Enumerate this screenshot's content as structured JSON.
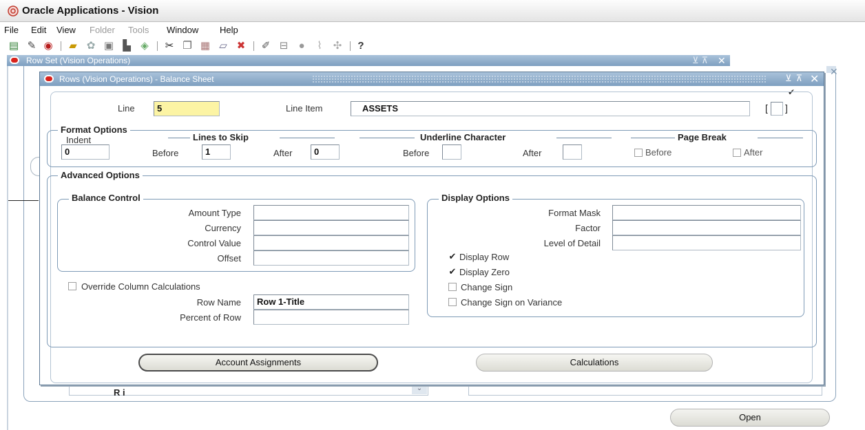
{
  "app": {
    "title": "Oracle Applications - Vision"
  },
  "menu": [
    {
      "label": "File",
      "enabled": true
    },
    {
      "label": "Edit",
      "enabled": true
    },
    {
      "label": "View",
      "enabled": true
    },
    {
      "label": "Folder",
      "enabled": false
    },
    {
      "label": "Tools",
      "enabled": false
    },
    {
      "label": "Window",
      "enabled": true
    },
    {
      "label": "Help",
      "enabled": true
    }
  ],
  "toolbar": {
    "icons": [
      "new-record-icon",
      "find-icon",
      "navigator-icon",
      "open-folder-icon",
      "save-icon",
      "switch-responsibility-icon",
      "print-icon",
      "close-form-icon",
      "cut-icon",
      "copy-icon",
      "paste-icon",
      "clear-record-icon",
      "delete-record-icon",
      "edit-field-icon",
      "zoom-icon",
      "translations-icon",
      "attachments-icon",
      "folder-tools-icon",
      "help-icon"
    ],
    "help_glyph": "?"
  },
  "rowset_window": {
    "title": "Row Set (Vision Operations)",
    "open_label": "Open",
    "back_field_text": "R     i"
  },
  "dialog": {
    "title": "Rows (Vision Operations) - Balance Sheet",
    "line": {
      "label": "Line",
      "value": "5"
    },
    "line_item": {
      "label": "Line Item",
      "value": "ASSETS"
    },
    "format_options": {
      "title": "Format Options",
      "indent": {
        "label": "Indent",
        "value": "0"
      },
      "lines_to_skip": {
        "title": "Lines to Skip",
        "before": {
          "label": "Before",
          "value": "1"
        },
        "after": {
          "label": "After",
          "value": "0"
        }
      },
      "underline_character": {
        "title": "Underline Character",
        "before": {
          "label": "Before",
          "value": ""
        },
        "after": {
          "label": "After",
          "value": ""
        }
      },
      "page_break": {
        "title": "Page Break",
        "before": {
          "label": "Before",
          "checked": false
        },
        "after": {
          "label": "After",
          "checked": false
        }
      }
    },
    "advanced_options": {
      "title": "Advanced Options",
      "balance_control": {
        "title": "Balance Control",
        "amount_type": {
          "label": "Amount Type",
          "value": ""
        },
        "currency": {
          "label": "Currency",
          "value": ""
        },
        "control_value": {
          "label": "Control Value",
          "value": ""
        },
        "offset": {
          "label": "Offset",
          "value": ""
        }
      },
      "override_column_calculations": {
        "label": "Override Column Calculations",
        "checked": false
      },
      "row_name": {
        "label": "Row Name",
        "value": "Row 1-Title"
      },
      "percent_of_row": {
        "label": "Percent of Row",
        "value": ""
      },
      "display_options": {
        "title": "Display Options",
        "format_mask": {
          "label": "Format Mask",
          "value": ""
        },
        "factor": {
          "label": "Factor",
          "value": ""
        },
        "level_of_detail": {
          "label": "Level of Detail",
          "value": ""
        },
        "display_row": {
          "label": "Display Row",
          "checked": true
        },
        "display_zero": {
          "label": "Display Zero",
          "checked": true
        },
        "change_sign": {
          "label": "Change Sign",
          "checked": false
        },
        "change_sign_on_variance": {
          "label": "Change Sign on Variance",
          "checked": false
        }
      }
    },
    "buttons": {
      "account_assignments": "Account Assignments",
      "calculations": "Calculations"
    }
  },
  "glyphs": {
    "check": "✔",
    "close": "✕",
    "window_ctrls": "⊻⊼",
    "dropdown": "⌄"
  }
}
